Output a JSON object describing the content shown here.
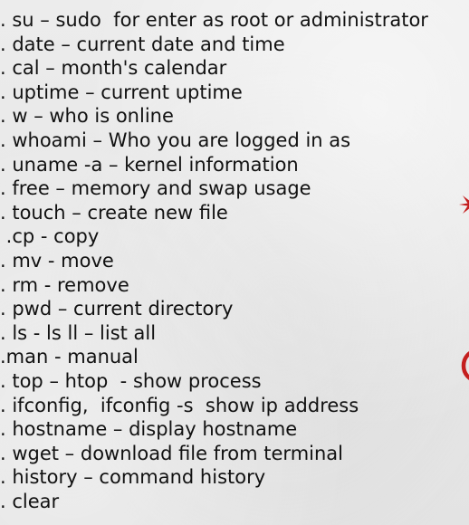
{
  "commands": [
    ". su – sudo  for enter as root or administrator",
    ". date – current date and time",
    ". cal – month's calendar",
    ". uptime – current uptime",
    ". w – who is online",
    ". whoami – Who you are logged in as",
    ". uname -a – kernel information",
    ". free – memory and swap usage",
    ". touch – create new file",
    " .cp - copy",
    ". mv - move",
    ". rm - remove",
    ". pwd – current directory",
    ". ls - ls ll – list all",
    ".man - manual",
    ". top – htop  - show process",
    ". ifconfig,  ifconfig -s  show ip address",
    ". hostname – display hostname",
    ". wget – download file from terminal",
    ". history – command history",
    ". clear"
  ],
  "decor": {
    "accent_color": "#c41e1e",
    "icons": [
      "star-burst-icon",
      "red-arc-icon"
    ]
  }
}
